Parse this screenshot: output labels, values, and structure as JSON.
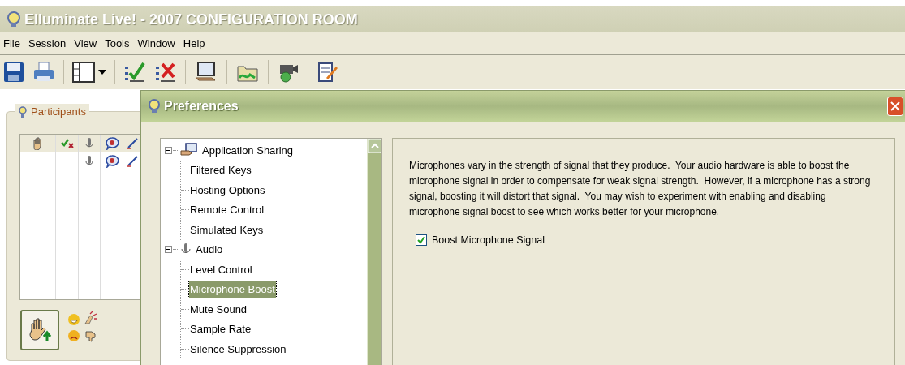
{
  "window": {
    "title": "Elluminate Live! - 2007 CONFIGURATION ROOM"
  },
  "menu": [
    "File",
    "Session",
    "View",
    "Tools",
    "Window",
    "Help"
  ],
  "participants": {
    "title": "Participants"
  },
  "dialog": {
    "title": "Preferences",
    "tree": [
      {
        "label": "Application Sharing",
        "kind": "sharing",
        "expanded": true,
        "selected": false,
        "children": [
          {
            "label": "Filtered Keys",
            "selected": false
          },
          {
            "label": "Hosting Options",
            "selected": false
          },
          {
            "label": "Remote Control",
            "selected": false
          },
          {
            "label": "Simulated Keys",
            "selected": false
          }
        ]
      },
      {
        "label": "Audio",
        "kind": "audio",
        "expanded": true,
        "selected": false,
        "children": [
          {
            "label": "Level Control",
            "selected": false
          },
          {
            "label": "Microphone Boost",
            "selected": true
          },
          {
            "label": "Mute Sound",
            "selected": false
          },
          {
            "label": "Sample Rate",
            "selected": false
          },
          {
            "label": "Silence Suppression",
            "selected": false
          }
        ]
      }
    ],
    "description": "Microphones vary in the strength of signal that they produce.  Your audio hardware is able to boost the microphone signal in order to compensate for weak signal strength.  However, if a microphone has a strong signal, boosting it will distort that signal.  You may wish to experiment with enabling and disabling microphone signal boost to see which works better for your microphone.",
    "checkbox": {
      "label": "Boost Microphone Signal",
      "checked": true
    }
  }
}
